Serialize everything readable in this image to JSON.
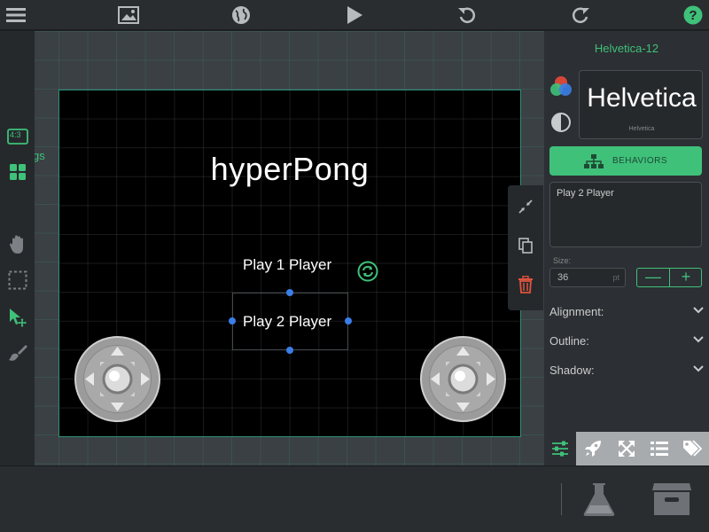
{
  "toolbar": {
    "icons": [
      "menu-icon",
      "image-icon",
      "globe-icon",
      "play-icon",
      "undo-icon",
      "redo-icon",
      "help-icon"
    ],
    "help_label": "?"
  },
  "left_tools": {
    "aspect_label": "4:3",
    "icons": [
      "aspect-ratio-icon",
      "grid-icon",
      "hand-icon",
      "marquee-select-icon",
      "pointer-move-icon",
      "brush-icon"
    ]
  },
  "workspace": {
    "partial_label": "gs"
  },
  "scene": {
    "title": "hyperPong",
    "play1": "Play 1 Player",
    "play2": "Play 2 Player"
  },
  "inspector": {
    "title": "Helvetica-12",
    "font_preview": "Helvetica",
    "font_preview_caption": "Helvetica",
    "behaviors_label": "BEHAVIORS",
    "text_value": "Play 2 Player",
    "size_label": "Size:",
    "size_value": "36",
    "size_unit": "pt",
    "minus": "—",
    "plus": "+",
    "sections": [
      "Alignment:",
      "Outline:",
      "Shadow:"
    ],
    "tabs": [
      "sliders-icon",
      "rocket-icon",
      "expand-icon",
      "list-icon",
      "tags-icon"
    ]
  },
  "bottom": {
    "icons": [
      "flask-icon",
      "archive-box-icon"
    ]
  },
  "colors": {
    "accent": "#3fc17a",
    "selection": "#3a7ee8",
    "delete": "#e0533d"
  }
}
